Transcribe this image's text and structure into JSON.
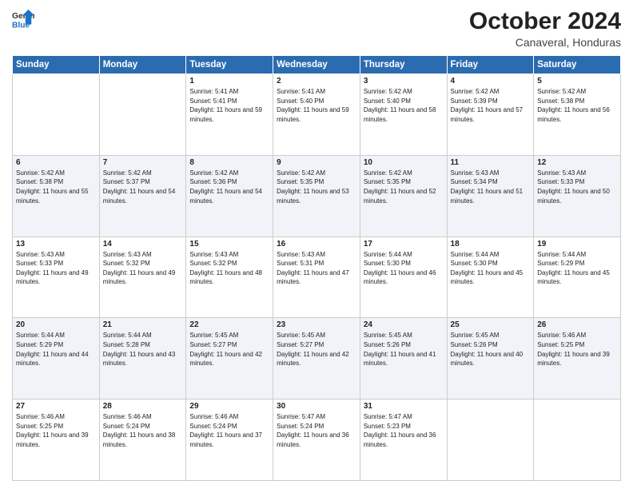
{
  "header": {
    "logo_line1": "General",
    "logo_line2": "Blue",
    "month": "October 2024",
    "location": "Canaveral, Honduras"
  },
  "weekdays": [
    "Sunday",
    "Monday",
    "Tuesday",
    "Wednesday",
    "Thursday",
    "Friday",
    "Saturday"
  ],
  "weeks": [
    [
      {
        "day": "",
        "info": ""
      },
      {
        "day": "",
        "info": ""
      },
      {
        "day": "1",
        "info": "Sunrise: 5:41 AM\nSunset: 5:41 PM\nDaylight: 11 hours and 59 minutes."
      },
      {
        "day": "2",
        "info": "Sunrise: 5:41 AM\nSunset: 5:40 PM\nDaylight: 11 hours and 59 minutes."
      },
      {
        "day": "3",
        "info": "Sunrise: 5:42 AM\nSunset: 5:40 PM\nDaylight: 11 hours and 58 minutes."
      },
      {
        "day": "4",
        "info": "Sunrise: 5:42 AM\nSunset: 5:39 PM\nDaylight: 11 hours and 57 minutes."
      },
      {
        "day": "5",
        "info": "Sunrise: 5:42 AM\nSunset: 5:38 PM\nDaylight: 11 hours and 56 minutes."
      }
    ],
    [
      {
        "day": "6",
        "info": "Sunrise: 5:42 AM\nSunset: 5:38 PM\nDaylight: 11 hours and 55 minutes."
      },
      {
        "day": "7",
        "info": "Sunrise: 5:42 AM\nSunset: 5:37 PM\nDaylight: 11 hours and 54 minutes."
      },
      {
        "day": "8",
        "info": "Sunrise: 5:42 AM\nSunset: 5:36 PM\nDaylight: 11 hours and 54 minutes."
      },
      {
        "day": "9",
        "info": "Sunrise: 5:42 AM\nSunset: 5:35 PM\nDaylight: 11 hours and 53 minutes."
      },
      {
        "day": "10",
        "info": "Sunrise: 5:42 AM\nSunset: 5:35 PM\nDaylight: 11 hours and 52 minutes."
      },
      {
        "day": "11",
        "info": "Sunrise: 5:43 AM\nSunset: 5:34 PM\nDaylight: 11 hours and 51 minutes."
      },
      {
        "day": "12",
        "info": "Sunrise: 5:43 AM\nSunset: 5:33 PM\nDaylight: 11 hours and 50 minutes."
      }
    ],
    [
      {
        "day": "13",
        "info": "Sunrise: 5:43 AM\nSunset: 5:33 PM\nDaylight: 11 hours and 49 minutes."
      },
      {
        "day": "14",
        "info": "Sunrise: 5:43 AM\nSunset: 5:32 PM\nDaylight: 11 hours and 49 minutes."
      },
      {
        "day": "15",
        "info": "Sunrise: 5:43 AM\nSunset: 5:32 PM\nDaylight: 11 hours and 48 minutes."
      },
      {
        "day": "16",
        "info": "Sunrise: 5:43 AM\nSunset: 5:31 PM\nDaylight: 11 hours and 47 minutes."
      },
      {
        "day": "17",
        "info": "Sunrise: 5:44 AM\nSunset: 5:30 PM\nDaylight: 11 hours and 46 minutes."
      },
      {
        "day": "18",
        "info": "Sunrise: 5:44 AM\nSunset: 5:30 PM\nDaylight: 11 hours and 45 minutes."
      },
      {
        "day": "19",
        "info": "Sunrise: 5:44 AM\nSunset: 5:29 PM\nDaylight: 11 hours and 45 minutes."
      }
    ],
    [
      {
        "day": "20",
        "info": "Sunrise: 5:44 AM\nSunset: 5:29 PM\nDaylight: 11 hours and 44 minutes."
      },
      {
        "day": "21",
        "info": "Sunrise: 5:44 AM\nSunset: 5:28 PM\nDaylight: 11 hours and 43 minutes."
      },
      {
        "day": "22",
        "info": "Sunrise: 5:45 AM\nSunset: 5:27 PM\nDaylight: 11 hours and 42 minutes."
      },
      {
        "day": "23",
        "info": "Sunrise: 5:45 AM\nSunset: 5:27 PM\nDaylight: 11 hours and 42 minutes."
      },
      {
        "day": "24",
        "info": "Sunrise: 5:45 AM\nSunset: 5:26 PM\nDaylight: 11 hours and 41 minutes."
      },
      {
        "day": "25",
        "info": "Sunrise: 5:45 AM\nSunset: 5:26 PM\nDaylight: 11 hours and 40 minutes."
      },
      {
        "day": "26",
        "info": "Sunrise: 5:46 AM\nSunset: 5:25 PM\nDaylight: 11 hours and 39 minutes."
      }
    ],
    [
      {
        "day": "27",
        "info": "Sunrise: 5:46 AM\nSunset: 5:25 PM\nDaylight: 11 hours and 39 minutes."
      },
      {
        "day": "28",
        "info": "Sunrise: 5:46 AM\nSunset: 5:24 PM\nDaylight: 11 hours and 38 minutes."
      },
      {
        "day": "29",
        "info": "Sunrise: 5:46 AM\nSunset: 5:24 PM\nDaylight: 11 hours and 37 minutes."
      },
      {
        "day": "30",
        "info": "Sunrise: 5:47 AM\nSunset: 5:24 PM\nDaylight: 11 hours and 36 minutes."
      },
      {
        "day": "31",
        "info": "Sunrise: 5:47 AM\nSunset: 5:23 PM\nDaylight: 11 hours and 36 minutes."
      },
      {
        "day": "",
        "info": ""
      },
      {
        "day": "",
        "info": ""
      }
    ]
  ]
}
